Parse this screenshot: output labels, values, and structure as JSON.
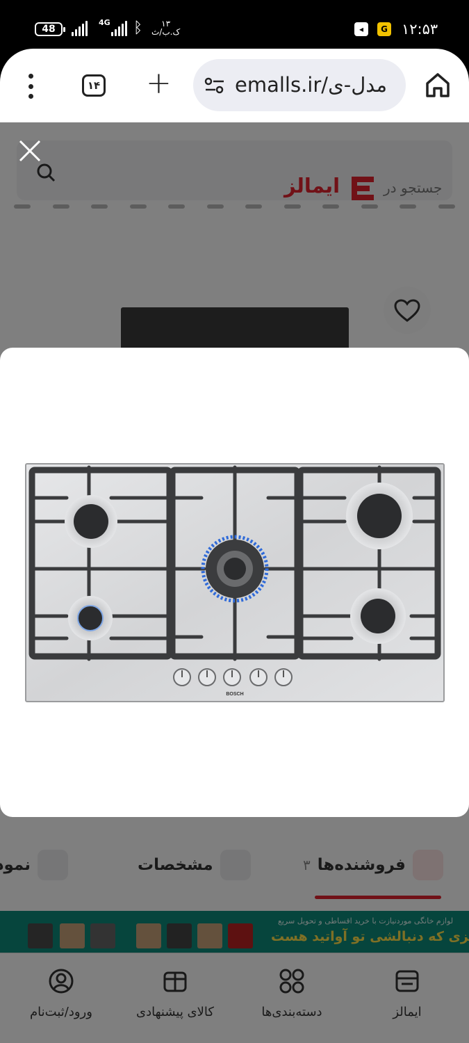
{
  "status_bar": {
    "battery": "48",
    "network": "4G",
    "speed": "۱۳\nک.ب/ث",
    "time": "۱۲:۵۳",
    "icons": [
      "telegram-icon",
      "g-app-icon",
      "bluetooth-icon",
      "signal-icon"
    ]
  },
  "browser": {
    "tab_count": "۱۴",
    "url": "emalls.ir/مدل-ی",
    "icons": [
      "more-vert-icon",
      "tabs-icon",
      "new-tab-plus-icon",
      "site-settings-icon",
      "home-icon"
    ]
  },
  "page": {
    "brand": "ایمالز",
    "search_placeholder": "جستجو در",
    "tabs": [
      {
        "label": "فروشنده‌ها",
        "count": "۳"
      },
      {
        "label": "مشخصات"
      },
      {
        "label": "نمودار ق"
      }
    ],
    "banner": {
      "line1": "لوازم خانگی موردنیازت با خرید اقساطی و تحویل سریع",
      "line2": "چیزی که دنبالشی تو آواتید هست"
    },
    "bottom_nav": [
      {
        "label": "ایمالز",
        "icon": "store-icon"
      },
      {
        "label": "دسته‌بندی‌ها",
        "icon": "categories-icon"
      },
      {
        "label": "کالای پیشنهادی",
        "icon": "gift-icon"
      },
      {
        "label": "ورود/ثبت‌نام",
        "icon": "user-icon"
      }
    ]
  },
  "modal": {
    "image_alt": "Bosch stainless steel 5-burner gas hob",
    "brand_on_product": "BOSCH"
  },
  "colors": {
    "accent": "#e2232e",
    "banner_bg": "#0d8a7b",
    "overlay": "rgba(0,0,0,0.5)",
    "steel": "#d8d9db",
    "grate": "#3a3b3d",
    "flame": "#2f6ad8"
  }
}
